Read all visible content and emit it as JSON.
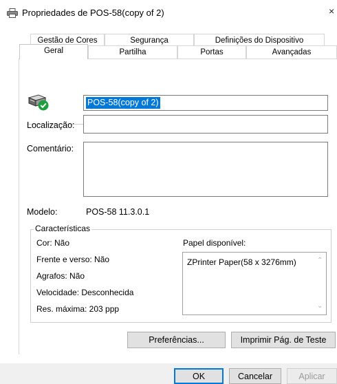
{
  "window": {
    "title": "Propriedades de POS-58(copy of 2)",
    "close_glyph": "×"
  },
  "tabs": {
    "back_row": [
      {
        "label": "Gestão de Cores"
      },
      {
        "label": "Segurança"
      },
      {
        "label": "Definições do Dispositivo"
      }
    ],
    "front_row": [
      {
        "label": "Geral",
        "active": true
      },
      {
        "label": "Partilha"
      },
      {
        "label": "Portas"
      },
      {
        "label": "Avançadas"
      }
    ]
  },
  "general": {
    "printer_name": "POS-58(copy of 2)",
    "location_label": "Localização:",
    "location_value": "",
    "comment_label": "Comentário:",
    "comment_value": "",
    "model_label": "Modelo:",
    "model_value": "POS-58 11.3.0.1"
  },
  "features": {
    "legend": "Características",
    "color": "Cor: Não",
    "duplex": "Frente e verso: Não",
    "staple": "Agrafos: Não",
    "speed": "Velocidade: Desconhecida",
    "resolution": "Res. máxima: 203 ppp",
    "paper_label": "Papel disponível:",
    "paper_items": [
      "ZPrinter Paper(58 x 3276mm)"
    ]
  },
  "buttons": {
    "preferences": "Preferências...",
    "print_test": "Imprimir Pág. de Teste",
    "ok": "OK",
    "cancel": "Cancelar",
    "apply": "Aplicar"
  },
  "colors": {
    "selection": "#0078d7",
    "status_ok": "#1e9e3e"
  },
  "icons": {
    "title": "printer-icon",
    "printer": "printer-ready-icon"
  }
}
